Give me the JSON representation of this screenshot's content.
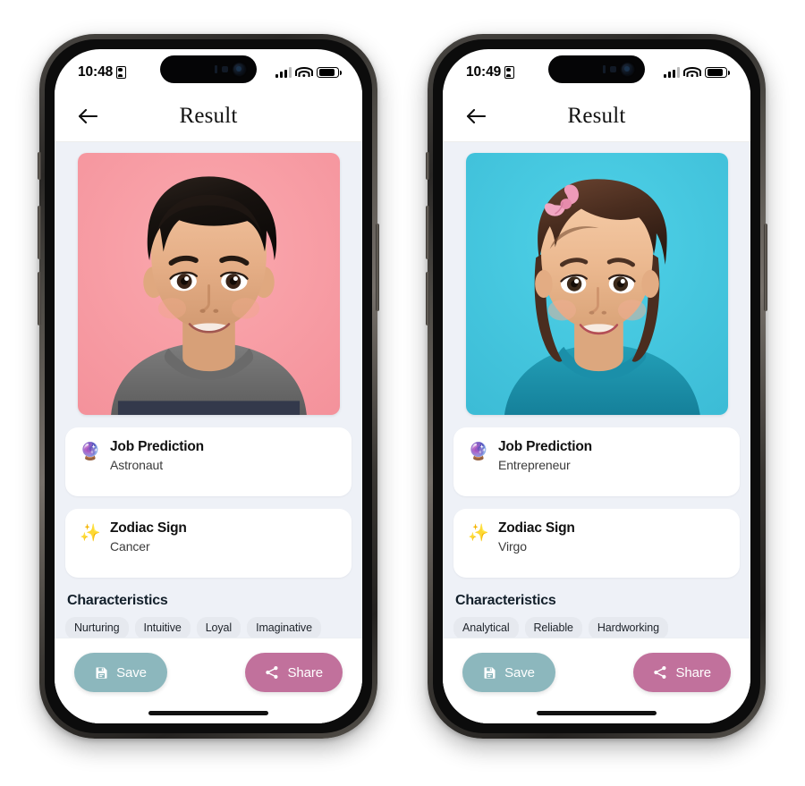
{
  "phones": [
    {
      "id": "left",
      "status": {
        "time": "10:48",
        "time_icon": "lock-recording-icon",
        "signal_icon": "cellular-signal-icon",
        "wifi_icon": "wifi-icon",
        "battery_icon": "battery-icon"
      },
      "nav": {
        "back_icon": "back-arrow-icon",
        "title": "Result"
      },
      "photo": {
        "name": "toddler-boy-portrait",
        "background_color": "#F79EA5",
        "shirt_color": "#6E6E6E",
        "hair_color": "#1C1714",
        "skin_color": "#E8B48C",
        "has_bow": false
      },
      "cards": [
        {
          "icon": "crystal-ball-icon",
          "emoji": "🔮",
          "title": "Job Prediction",
          "value": "Astronaut"
        },
        {
          "icon": "sparkles-icon",
          "emoji": "✨",
          "title": "Zodiac Sign",
          "value": "Cancer"
        }
      ],
      "characteristics": {
        "heading": "Characteristics",
        "chips": [
          "Nurturing",
          "Intuitive",
          "Loyal",
          "Imaginative"
        ]
      },
      "actions": {
        "save": {
          "label": "Save",
          "icon": "floppy-disk-save-icon",
          "color": "#8CB7BD"
        },
        "share": {
          "label": "Share",
          "icon": "share-nodes-icon",
          "color": "#C1719C"
        }
      }
    },
    {
      "id": "right",
      "status": {
        "time": "10:49",
        "time_icon": "lock-recording-icon",
        "signal_icon": "cellular-signal-icon",
        "wifi_icon": "wifi-icon",
        "battery_icon": "battery-icon"
      },
      "nav": {
        "back_icon": "back-arrow-icon",
        "title": "Result"
      },
      "photo": {
        "name": "toddler-girl-portrait",
        "background_color": "#45C8E0",
        "shirt_color": "#1D90A8",
        "hair_color": "#4A2E22",
        "skin_color": "#EDC09A",
        "has_bow": true,
        "bow_color": "#F0A0BE"
      },
      "cards": [
        {
          "icon": "crystal-ball-icon",
          "emoji": "🔮",
          "title": "Job Prediction",
          "value": "Entrepreneur"
        },
        {
          "icon": "sparkles-icon",
          "emoji": "✨",
          "title": "Zodiac Sign",
          "value": "Virgo"
        }
      ],
      "characteristics": {
        "heading": "Characteristics",
        "chips": [
          "Analytical",
          "Reliable",
          "Hardworking"
        ]
      },
      "actions": {
        "save": {
          "label": "Save",
          "icon": "floppy-disk-save-icon",
          "color": "#8CB7BD"
        },
        "share": {
          "label": "Share",
          "icon": "share-nodes-icon",
          "color": "#C1719C"
        }
      }
    }
  ],
  "theme": {
    "page_background": "#FFFFFF",
    "screen_background": "#EEF1F7",
    "card_background": "#FFFFFF",
    "chip_background": "#E6E9EF",
    "accent_save": "#8CB7BD",
    "accent_share": "#C1719C",
    "frame_color": "#3A3734"
  }
}
